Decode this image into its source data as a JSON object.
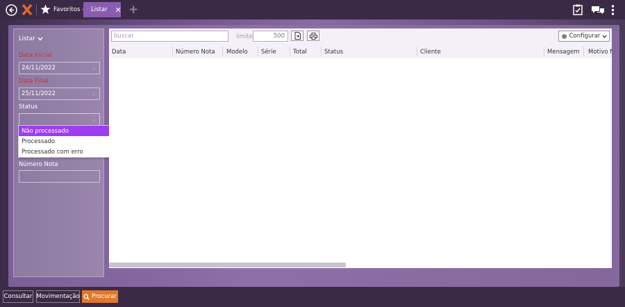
{
  "topbar": {
    "favorites_label": "Favoritos -",
    "active_tab": "Listar"
  },
  "left_panel": {
    "title": "Listar",
    "data_inicial_label": "Data Inicial",
    "data_inicial_value": "24/11/2022",
    "data_final_label": "Data Final",
    "data_final_value": "25/11/2022",
    "status_label": "Status",
    "status_options": [
      "Não processado",
      "Processado",
      "Processado com erro"
    ],
    "numero_nota_label": "Número Nota"
  },
  "toolbar": {
    "search_placeholder": "buscar",
    "limite_label": "limite:",
    "limite_value": "500",
    "config_label": "Configurar"
  },
  "table": {
    "columns": [
      "Data",
      "Número Nota",
      "Modelo",
      "Série",
      "Total",
      "Status",
      "Cliente",
      "Mensagem",
      "Motivo N"
    ]
  },
  "bottom": {
    "consultar": "Consultar",
    "movimentacao": "Movimentação",
    "procurar": "Procurar"
  },
  "colors": {
    "accent": "#8b5db1",
    "selected": "#9f3df0",
    "primary_button": "#e0782b",
    "required_label": "#c43434"
  }
}
